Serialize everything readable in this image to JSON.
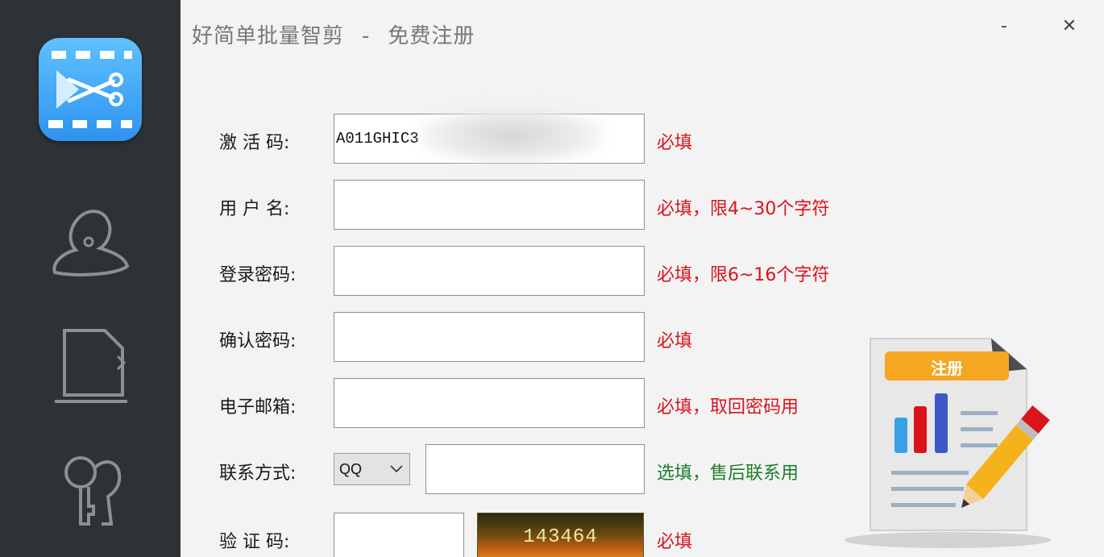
{
  "window": {
    "title_app": "好简单批量智剪",
    "title_separator": "-",
    "title_page": "免费注册",
    "minimize_label": "-",
    "close_label": "✕"
  },
  "sidebar": {
    "logo_icon": "scissors-film-icon",
    "items": [
      {
        "icon": "user-icon"
      },
      {
        "icon": "document-icon"
      },
      {
        "icon": "key-icon"
      }
    ]
  },
  "form": {
    "activation_code": {
      "label": "激 活 码:",
      "value": "A011GHIC3",
      "hint": "必填"
    },
    "username": {
      "label": "用 户 名:",
      "value": "",
      "hint": "必填，限4~30个字符"
    },
    "password": {
      "label": "登录密码:",
      "value": "",
      "hint": "必填，限6~16个字符"
    },
    "confirm_password": {
      "label": "确认密码:",
      "value": "",
      "hint": "必填"
    },
    "email": {
      "label": "电子邮箱:",
      "value": "",
      "hint": "必填，取回密码用"
    },
    "contact": {
      "label": "联系方式:",
      "type_selected": "QQ",
      "value": "",
      "hint": "选填，售后联系用"
    },
    "captcha": {
      "label": "验 证 码:",
      "value": "",
      "image_text": "143464",
      "hint": "必填"
    }
  },
  "register_button": {
    "label": "注册"
  },
  "colors": {
    "sidebar_bg": "#2e3135",
    "required_hint": "#d9141b",
    "optional_hint": "#1e7d2a",
    "logo_blue": "#2f93f0",
    "register_orange": "#f5a623"
  }
}
